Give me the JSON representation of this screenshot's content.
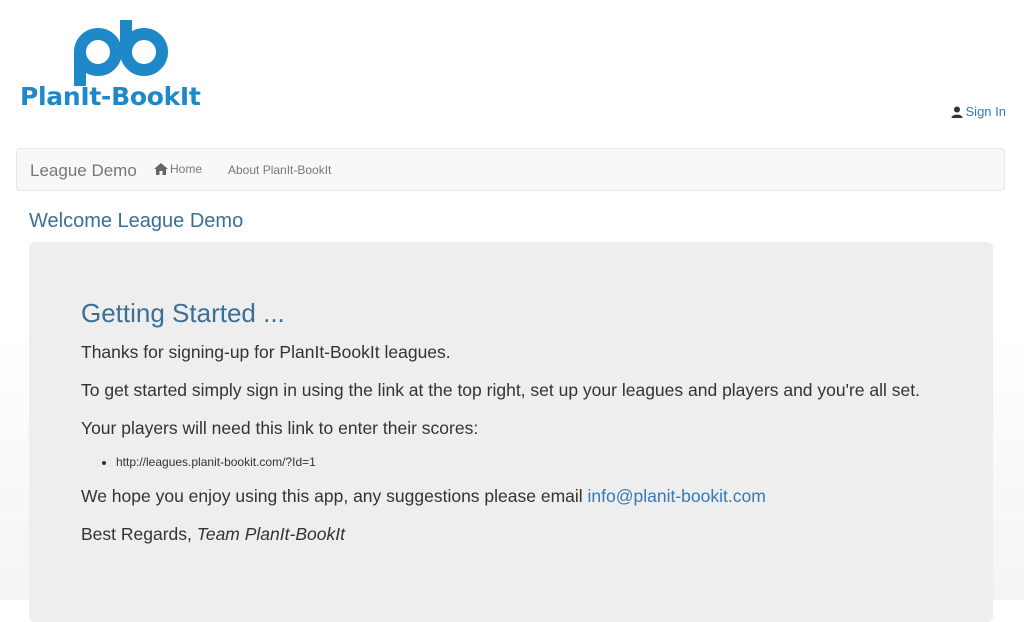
{
  "header": {
    "logo_text": "PlanIt-BookIt",
    "signin_label": "Sign In"
  },
  "navbar": {
    "brand": "League Demo",
    "home_label": "Home",
    "about_label": "About PlanIt-BookIt"
  },
  "page": {
    "welcome": "Welcome League Demo"
  },
  "content": {
    "heading": "Getting Started ...",
    "intro": "Thanks for signing-up for PlanIt-BookIt leagues.",
    "instructions": "To get started simply sign in using the link at the top right, set up your leagues and players and you're all set.",
    "players_note": "Your players will need this link to enter their scores:",
    "league_link": "http://leagues.planit-bookit.com/?Id=1",
    "enjoy_text": "We hope you enjoy using this app, any suggestions please email ",
    "email": "info@planit-bookit.com",
    "regards": "Best Regards, ",
    "team": "Team PlanIt-BookIt"
  },
  "colors": {
    "brand_blue": "#1e88c8",
    "link_blue": "#337ab7",
    "heading_blue": "#3a6f96",
    "jumbotron_bg": "#eeeeee",
    "navbar_bg": "#f8f8f8"
  },
  "icons": {
    "signin": "user-icon",
    "home": "home-icon"
  }
}
